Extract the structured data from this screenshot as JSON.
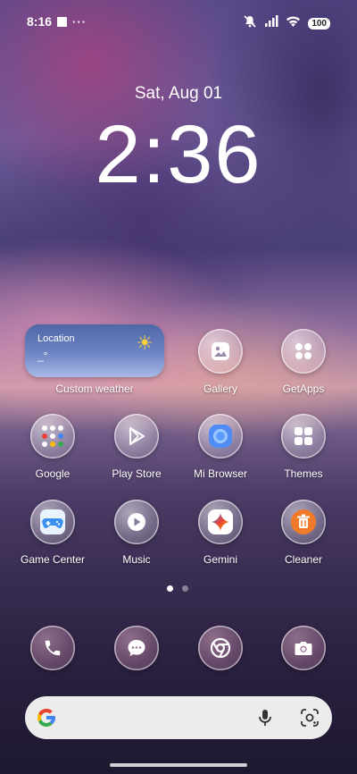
{
  "status_bar": {
    "time": "8:16",
    "dots": "···",
    "battery": "100"
  },
  "lock_widget": {
    "date": "Sat, Aug 01",
    "time": "2:36"
  },
  "weather": {
    "location": "Location",
    "temp": "_°",
    "label": "Custom weather"
  },
  "apps": [
    {
      "label": "Gallery",
      "icon": "gallery-icon"
    },
    {
      "label": "GetApps",
      "icon": "getapps-icon"
    },
    {
      "label": "Google",
      "icon": "google-folder-icon"
    },
    {
      "label": "Play Store",
      "icon": "play-store-icon"
    },
    {
      "label": "Mi Browser",
      "icon": "mi-browser-icon"
    },
    {
      "label": "Themes",
      "icon": "themes-icon"
    },
    {
      "label": "Game Center",
      "icon": "game-center-icon"
    },
    {
      "label": "Music",
      "icon": "music-icon"
    },
    {
      "label": "Gemini",
      "icon": "gemini-icon"
    },
    {
      "label": "Cleaner",
      "icon": "cleaner-icon"
    }
  ],
  "dock": [
    {
      "icon": "phone-icon"
    },
    {
      "icon": "messages-icon"
    },
    {
      "icon": "chrome-icon"
    },
    {
      "icon": "camera-icon"
    }
  ],
  "page_indicator": {
    "pages": 2,
    "current": 1
  },
  "colors": {
    "accent_orange": "#f07a2a",
    "google_blue": "#4285F4",
    "google_red": "#EA4335",
    "google_yellow": "#FBBC05",
    "google_green": "#34A853"
  }
}
